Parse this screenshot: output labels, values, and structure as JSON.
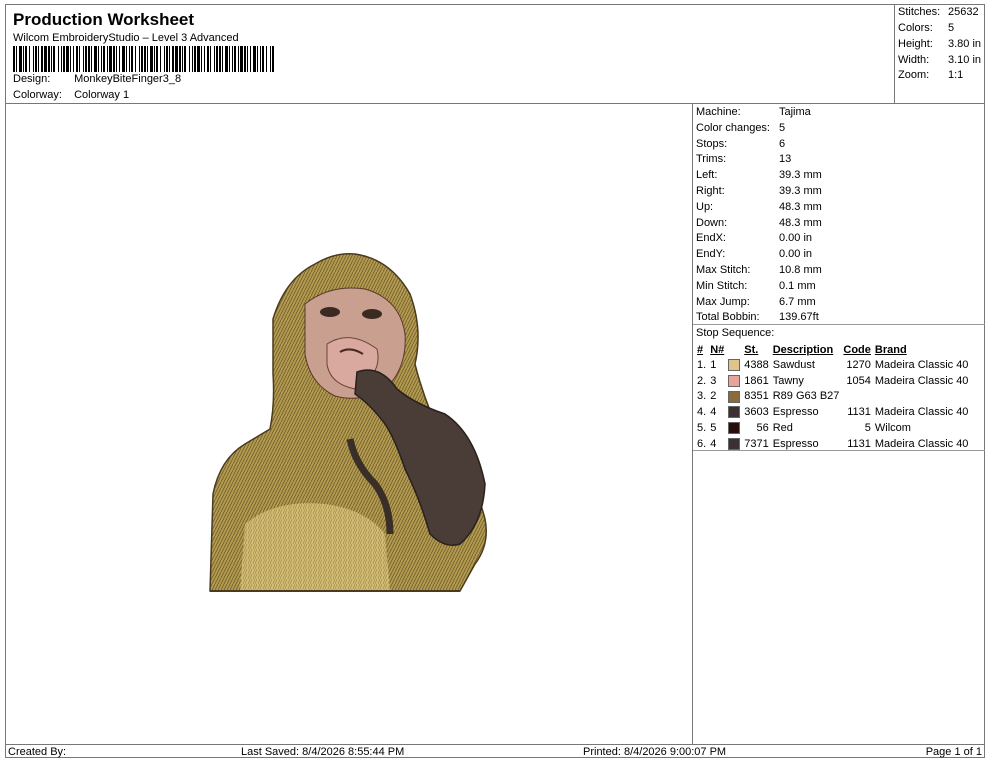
{
  "header": {
    "title": "Production Worksheet",
    "subtitle": "Wilcom EmbroideryStudio – Level 3 Advanced",
    "design_label": "Design:",
    "design_value": "MonkeyBiteFinger3_8",
    "colorway_label": "Colorway:",
    "colorway_value": "Colorway 1"
  },
  "summary": [
    {
      "label": "Stitches:",
      "value": "25632"
    },
    {
      "label": "Colors:",
      "value": "5"
    },
    {
      "label": "Height:",
      "value": "3.80 in"
    },
    {
      "label": "Width:",
      "value": "3.10 in"
    },
    {
      "label": "Zoom:",
      "value": "1:1"
    }
  ],
  "stats": [
    {
      "label": "Machine:",
      "value": "Tajima"
    },
    {
      "label": "Color changes:",
      "value": "5"
    },
    {
      "label": "Stops:",
      "value": "6"
    },
    {
      "label": "Trims:",
      "value": "13"
    },
    {
      "label": "Left:",
      "value": "39.3 mm"
    },
    {
      "label": "Right:",
      "value": "39.3 mm"
    },
    {
      "label": "Up:",
      "value": "48.3 mm"
    },
    {
      "label": "Down:",
      "value": "48.3 mm"
    },
    {
      "label": "EndX:",
      "value": "0.00 in"
    },
    {
      "label": "EndY:",
      "value": "0.00 in"
    },
    {
      "label": "Max Stitch:",
      "value": "10.8 mm"
    },
    {
      "label": "Min Stitch:",
      "value": "0.1 mm"
    },
    {
      "label": "Max Jump:",
      "value": "6.7 mm"
    },
    {
      "label": "Total Bobbin:",
      "value": "139.67ft"
    }
  ],
  "stop_sequence": {
    "title": "Stop Sequence:",
    "columns": [
      "#",
      "N#",
      "St.",
      "Description",
      "Code",
      "Brand"
    ],
    "rows": [
      {
        "idx": "1.",
        "n": "1",
        "color": "#e2c48a",
        "st": "4388",
        "desc": "Sawdust",
        "code": "1270",
        "brand": "Madeira Classic 40"
      },
      {
        "idx": "2.",
        "n": "3",
        "color": "#e8a39a",
        "st": "1861",
        "desc": "Tawny",
        "code": "1054",
        "brand": "Madeira Classic 40"
      },
      {
        "idx": "3.",
        "n": "2",
        "color": "#8b6a3b",
        "st": "8351",
        "desc": "R89 G63 B27",
        "code": "",
        "brand": ""
      },
      {
        "idx": "4.",
        "n": "4",
        "color": "#3b3133",
        "st": "3603",
        "desc": "Espresso",
        "code": "1131",
        "brand": "Madeira Classic 40"
      },
      {
        "idx": "5.",
        "n": "5",
        "color": "#2a0c0c",
        "st": "56",
        "desc": "Red",
        "code": "5",
        "brand": "Wilcom"
      },
      {
        "idx": "6.",
        "n": "4",
        "color": "#3b3133",
        "st": "7371",
        "desc": "Espresso",
        "code": "1131",
        "brand": "Madeira Classic 40"
      }
    ]
  },
  "footer": {
    "created_by": "Created By:",
    "last_saved": "Last Saved: 8/4/2026 8:55:44 PM",
    "printed": "Printed: 8/4/2026 9:00:07 PM",
    "page": "Page 1 of 1"
  }
}
